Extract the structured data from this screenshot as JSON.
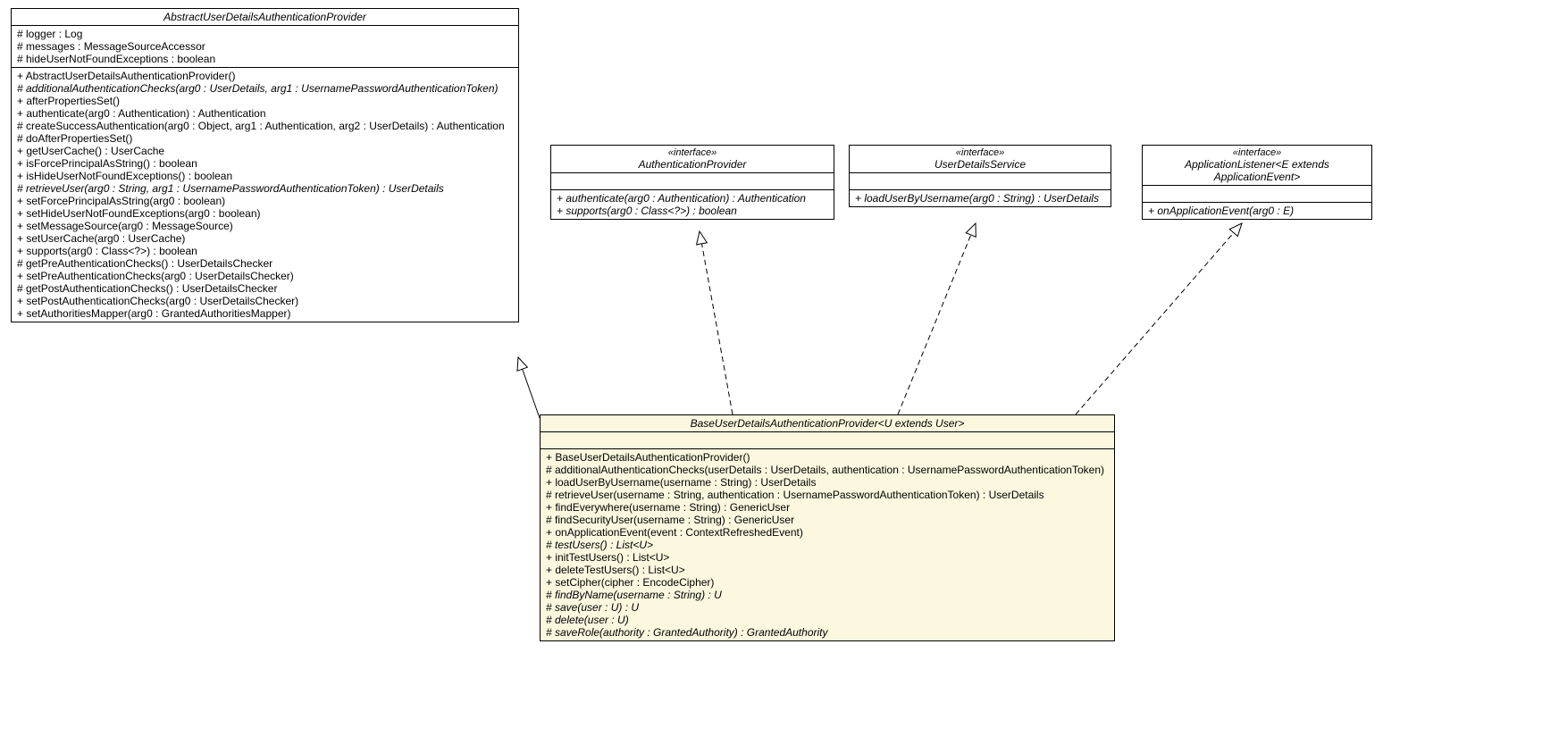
{
  "classes": {
    "abstract": {
      "name": "AbstractUserDetailsAuthenticationProvider",
      "attrs": [
        {
          "t": "# logger : Log"
        },
        {
          "t": "# messages : MessageSourceAccessor"
        },
        {
          "t": "# hideUserNotFoundExceptions : boolean"
        }
      ],
      "ops": [
        {
          "t": "+ AbstractUserDetailsAuthenticationProvider()"
        },
        {
          "t": "# additionalAuthenticationChecks(arg0 : UserDetails, arg1 : UsernamePasswordAuthenticationToken)",
          "i": true
        },
        {
          "t": "+ afterPropertiesSet()"
        },
        {
          "t": "+ authenticate(arg0 : Authentication) : Authentication"
        },
        {
          "t": "# createSuccessAuthentication(arg0 : Object, arg1 : Authentication, arg2 : UserDetails) : Authentication"
        },
        {
          "t": "# doAfterPropertiesSet()"
        },
        {
          "t": "+ getUserCache() : UserCache"
        },
        {
          "t": "+ isForcePrincipalAsString() : boolean"
        },
        {
          "t": "+ isHideUserNotFoundExceptions() : boolean"
        },
        {
          "t": "# retrieveUser(arg0 : String, arg1 : UsernamePasswordAuthenticationToken) : UserDetails",
          "i": true
        },
        {
          "t": "+ setForcePrincipalAsString(arg0 : boolean)"
        },
        {
          "t": "+ setHideUserNotFoundExceptions(arg0 : boolean)"
        },
        {
          "t": "+ setMessageSource(arg0 : MessageSource)"
        },
        {
          "t": "+ setUserCache(arg0 : UserCache)"
        },
        {
          "t": "+ supports(arg0 : Class<?>) : boolean"
        },
        {
          "t": "# getPreAuthenticationChecks() : UserDetailsChecker"
        },
        {
          "t": "+ setPreAuthenticationChecks(arg0 : UserDetailsChecker)"
        },
        {
          "t": "# getPostAuthenticationChecks() : UserDetailsChecker"
        },
        {
          "t": "+ setPostAuthenticationChecks(arg0 : UserDetailsChecker)"
        },
        {
          "t": "+ setAuthoritiesMapper(arg0 : GrantedAuthoritiesMapper)"
        }
      ]
    },
    "authProvider": {
      "stereo": "«interface»",
      "name": "AuthenticationProvider",
      "ops": [
        {
          "t": "+ authenticate(arg0 : Authentication) : Authentication",
          "i": true
        },
        {
          "t": "+ supports(arg0 : Class<?>) : boolean",
          "i": true
        }
      ]
    },
    "userDetailsService": {
      "stereo": "«interface»",
      "name": "UserDetailsService",
      "ops": [
        {
          "t": "+ loadUserByUsername(arg0 : String) : UserDetails",
          "i": true
        }
      ]
    },
    "appListener": {
      "stereo": "«interface»",
      "name": "ApplicationListener<E extends ApplicationEvent>",
      "ops": [
        {
          "t": "+ onApplicationEvent(arg0 : E)",
          "i": true
        }
      ]
    },
    "base": {
      "name": "BaseUserDetailsAuthenticationProvider<U extends User>",
      "ops": [
        {
          "t": "+ BaseUserDetailsAuthenticationProvider()"
        },
        {
          "t": "# additionalAuthenticationChecks(userDetails : UserDetails, authentication : UsernamePasswordAuthenticationToken)"
        },
        {
          "t": "+ loadUserByUsername(username : String) : UserDetails"
        },
        {
          "t": "# retrieveUser(username : String, authentication : UsernamePasswordAuthenticationToken) : UserDetails"
        },
        {
          "t": "+ findEverywhere(username : String) : GenericUser"
        },
        {
          "t": "# findSecurityUser(username : String) : GenericUser"
        },
        {
          "t": "+ onApplicationEvent(event : ContextRefreshedEvent)"
        },
        {
          "t": "# testUsers() : List<U>",
          "i": true
        },
        {
          "t": "+ initTestUsers() : List<U>"
        },
        {
          "t": "+ deleteTestUsers() : List<U>"
        },
        {
          "t": "+ setCipher(cipher : EncodeCipher)"
        },
        {
          "t": "# findByName(username : String) : U",
          "i": true
        },
        {
          "t": "# save(user : U) : U",
          "i": true
        },
        {
          "t": "# delete(user : U)",
          "i": true
        },
        {
          "t": "# saveRole(authority : GrantedAuthority) : GrantedAuthority",
          "i": true
        }
      ]
    }
  }
}
